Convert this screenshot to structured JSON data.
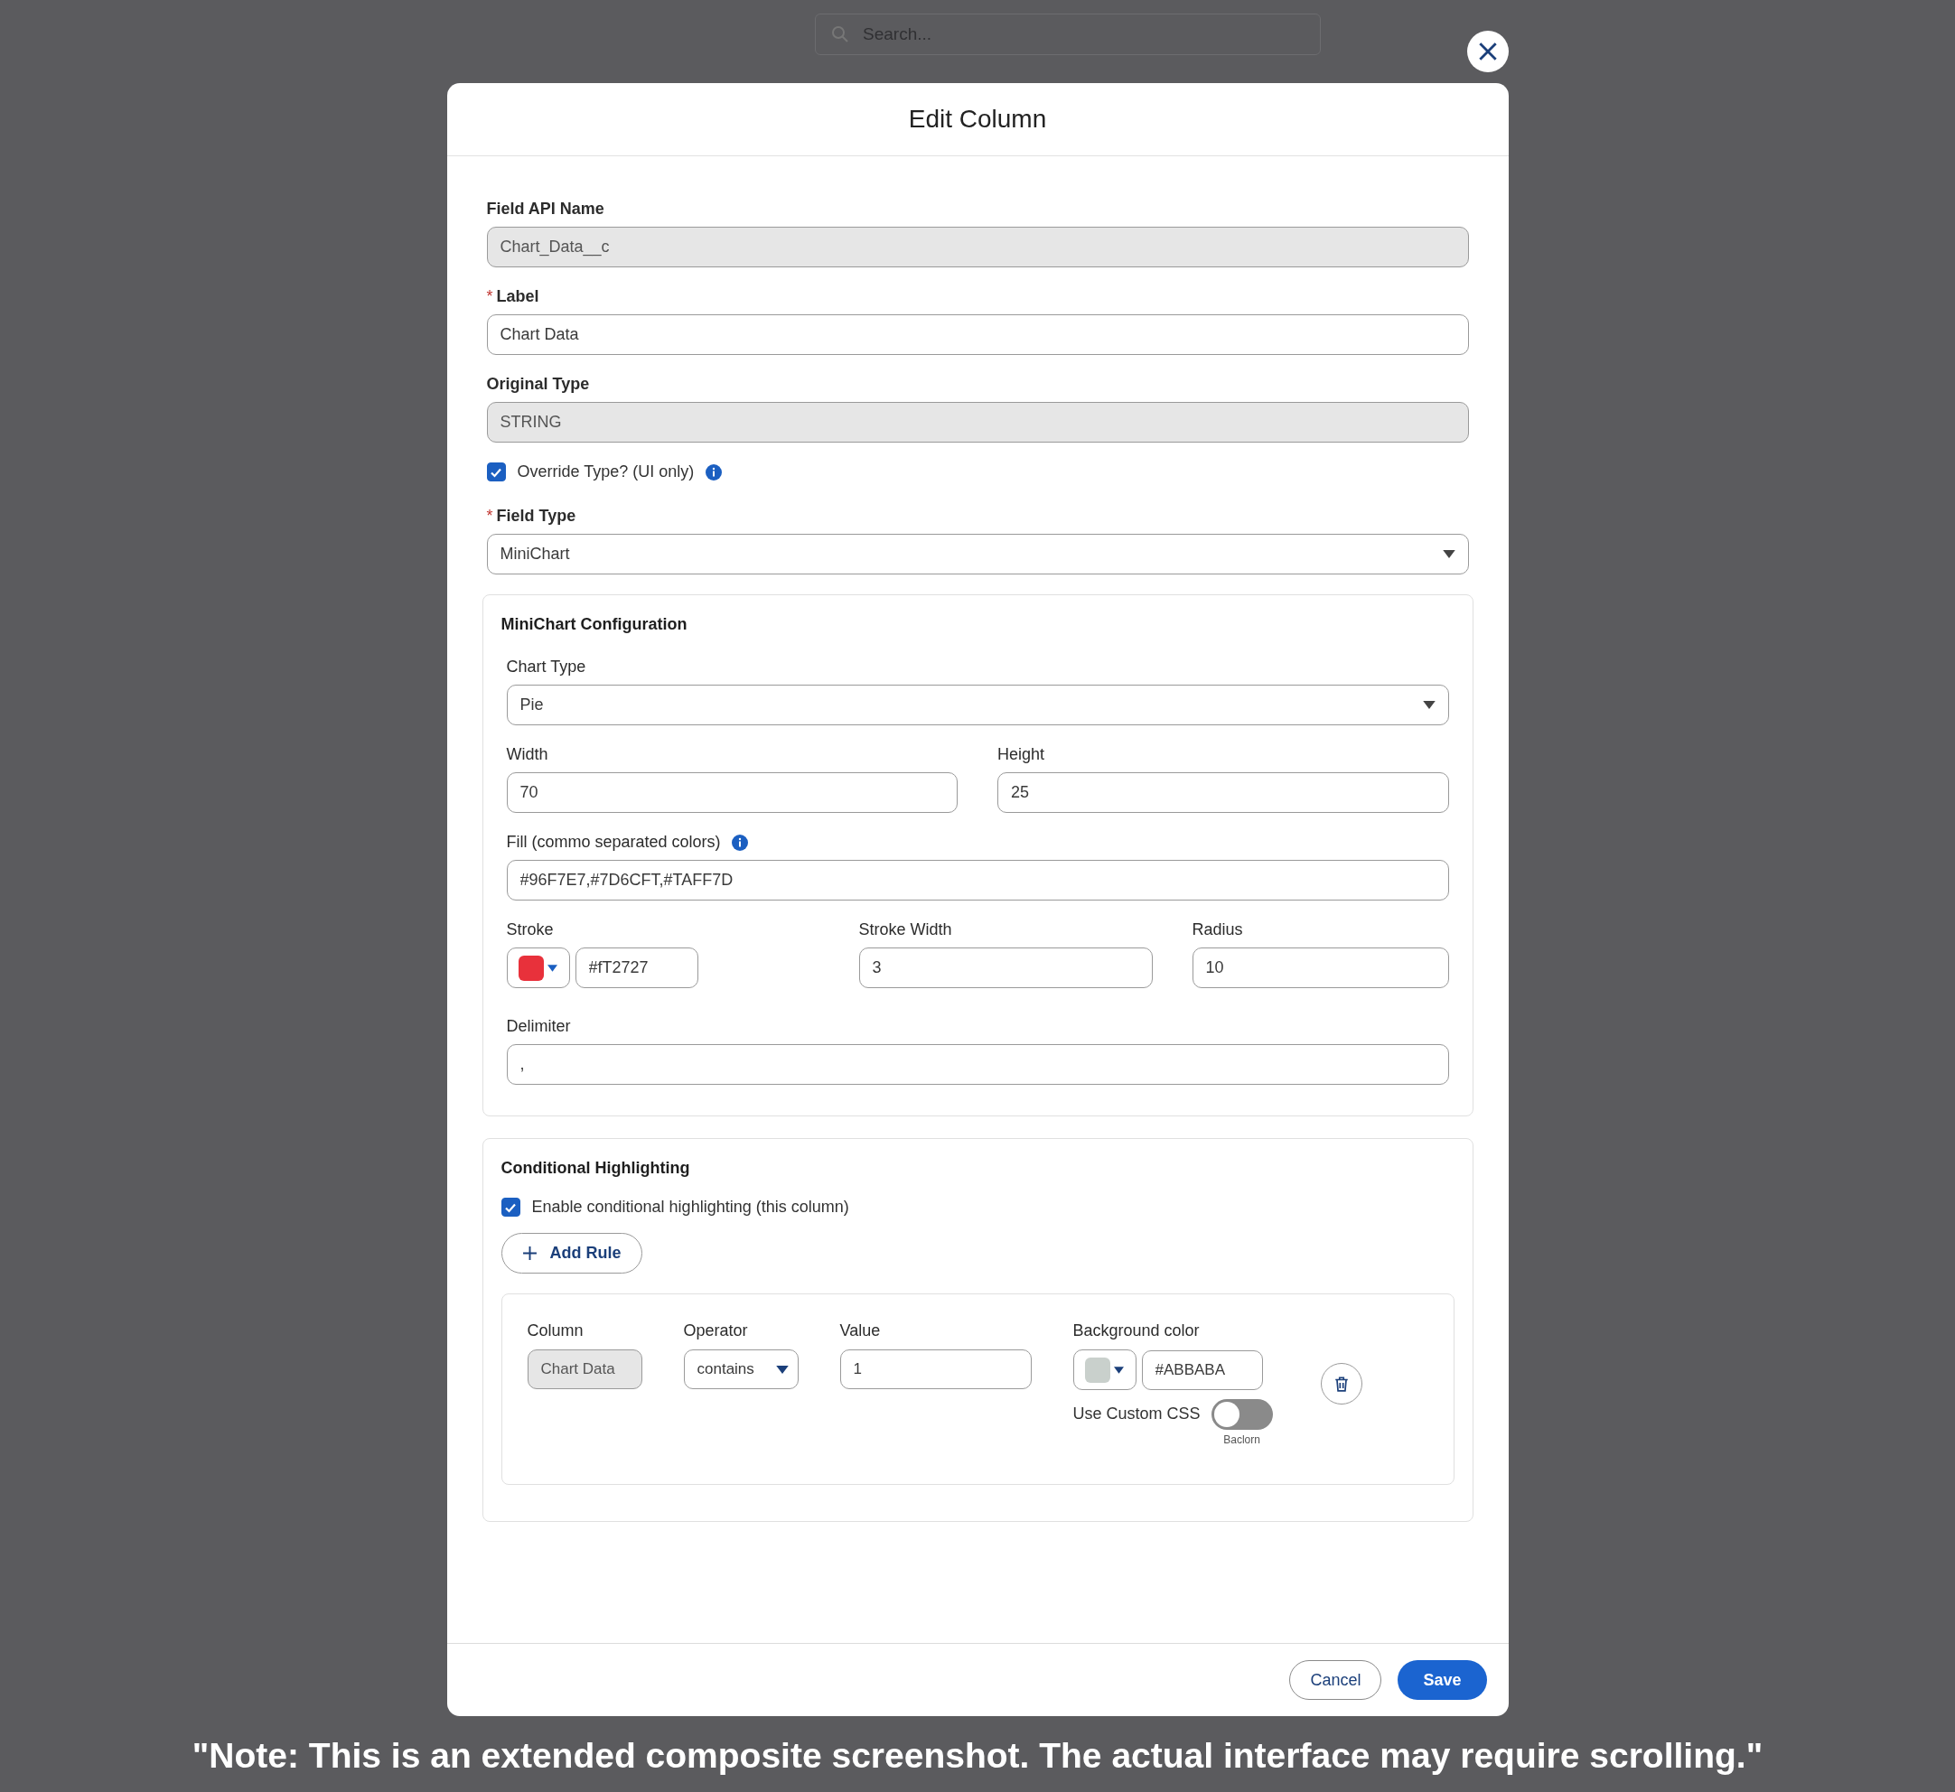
{
  "search": {
    "placeholder": "Search..."
  },
  "modal": {
    "title": "Edit Column"
  },
  "fields": [
    {
      "label": "Field API Name",
      "value": "Chart_Data__c",
      "disabled": true
    },
    {
      "label": "Label",
      "required_mark": "*",
      "value": "Chart Data",
      "disabled": false
    },
    {
      "label": "Original Type",
      "value": "STRING",
      "disabled": true
    }
  ],
  "override": {
    "label": "Override Type? (UI only)",
    "checked": true
  },
  "field_type": {
    "label": "Field Type",
    "required_mark": "*",
    "value": "MiniChart"
  },
  "minichart": {
    "title": "MiniChart Configuration",
    "chart_type": {
      "label": "Chart Type",
      "value": "Pie"
    },
    "width": {
      "label": "Width",
      "value": "70"
    },
    "height": {
      "label": "Height",
      "value": "25"
    },
    "fill": {
      "label": "Fill (commo separated colors)",
      "value": "#96F7E7,#7D6CFT,#TAFF7D"
    },
    "stroke": {
      "label": "Stroke",
      "color": "#e8313b",
      "value": "#fT2727"
    },
    "stroke_width": {
      "label": "Stroke Width",
      "value": "3"
    },
    "radius": {
      "label": "Radius",
      "value": "10"
    },
    "delimiter": {
      "label": "Delimiter",
      "value": ","
    }
  },
  "highlighting": {
    "title": "Conditional Highlighting",
    "enable": {
      "label": "Enable conditional highlighting (this column)",
      "checked": true
    },
    "add_rule": "Add Rule",
    "rules": [
      {
        "column": {
          "label": "Column",
          "value": "Chart Data"
        },
        "operator": {
          "label": "Operator",
          "value": "contains"
        },
        "value": {
          "label": "Value",
          "value": "1"
        },
        "background": {
          "label": "Background color",
          "color": "#c9d0cc",
          "value": "#ABBABA"
        },
        "custom_css": {
          "label": "Use Custom CSS",
          "on": false,
          "caption": "Baclorn"
        }
      }
    ]
  },
  "footer": {
    "cancel": "Cancel",
    "save": "Save"
  },
  "note": "\"Note: This is an extended composite screenshot. The actual interface may require scrolling.\""
}
